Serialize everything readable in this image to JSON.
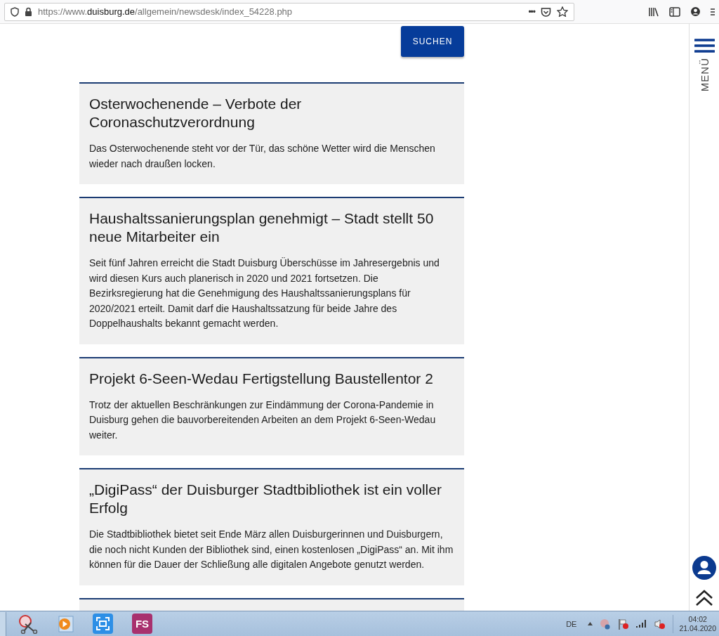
{
  "browser": {
    "url": "https://www.**duisburg.de**/allgemein/newsdesk/index_54228.php",
    "more": "•••"
  },
  "search_button": {
    "label": "SUCHEN"
  },
  "articles": [
    {
      "kind": "full",
      "title": "Osterwochenende – Verbote der Coronaschutzverordnung",
      "text": "Das Osterwochenende steht vor der Tür, das schöne Wetter wird die Menschen wieder nach draußen locken."
    },
    {
      "kind": "full",
      "title": "Haushaltssanierungsplan genehmigt – Stadt stellt 50 neue Mitarbeiter ein",
      "text": "Seit fünf Jahren erreicht die Stadt Duisburg Überschüsse im Jahresergebnis und wird diesen Kurs auch planerisch in 2020 und 2021 fortsetzen. Die Bezirksregierung hat die Genehmigung des Haushaltssanierungsplans für 2020/2021 erteilt. Damit darf die Haushaltssatzung für beide Jahre des Doppelhaushalts bekannt gemacht werden."
    },
    {
      "kind": "full",
      "title": "Projekt 6-Seen-Wedau Fertigstellung Baustellentor 2",
      "text": "Trotz der aktuellen Beschränkungen zur Eindämmung der Corona-Pandemie in Duisburg gehen die bauvorbereitenden Arbeiten an dem Projekt 6-Seen-Wedau weiter."
    },
    {
      "kind": "full",
      "title": "„DigiPass“ der Duisburger Stadtbibliothek ist ein voller Erfolg",
      "text": "Die Stadtbibliothek bietet seit Ende März allen Duisburgerinnen und Duisburgern, die noch nicht Kunden der Bibliothek sind, einen kostenlosen „DigiPass“ an. Mit ihm können für die Dauer der Schließung alle digitalen Angebote genutzt werden."
    },
    {
      "kind": "cut-off"
    }
  ],
  "sidebar": {
    "menu_label": "MENÜ"
  },
  "taskbar": {
    "apps": [
      {
        "kind": "snip"
      },
      {
        "kind": "player"
      },
      {
        "kind": "capture"
      },
      {
        "kind": "fs",
        "label": "FS"
      }
    ],
    "language": "DE",
    "time": "04:02",
    "date": "21.04.2020"
  }
}
